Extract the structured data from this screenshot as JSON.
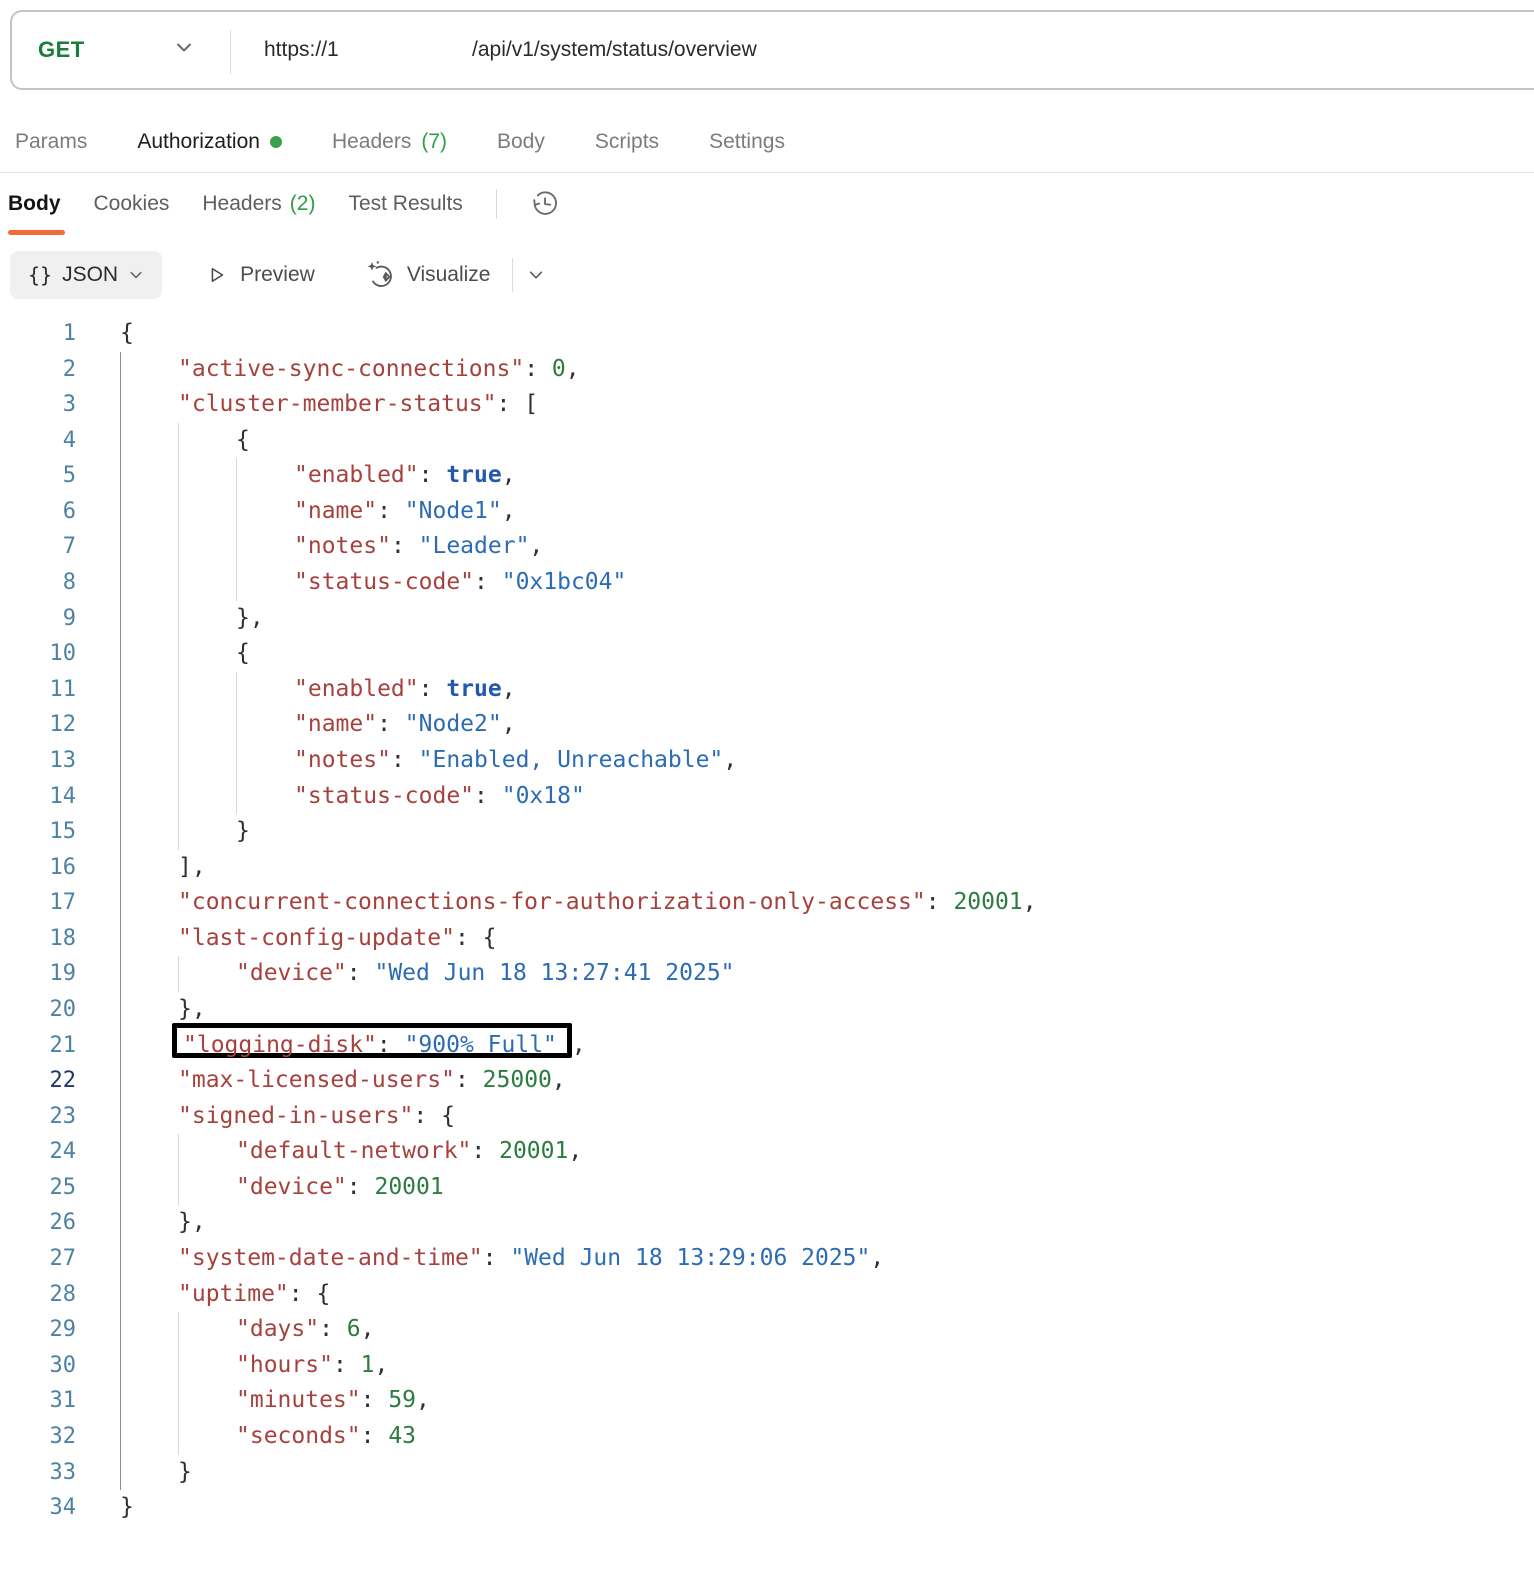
{
  "request_bar": {
    "method": "GET",
    "url_host": "https://1",
    "url_path": "/api/v1/system/status/overview"
  },
  "request_tabs": {
    "items": [
      {
        "label": "Params"
      },
      {
        "label": "Authorization",
        "active": true,
        "dot": true
      },
      {
        "label": "Headers",
        "count": "(7)"
      },
      {
        "label": "Body"
      },
      {
        "label": "Scripts"
      },
      {
        "label": "Settings"
      }
    ]
  },
  "response_tabs": {
    "items": [
      {
        "label": "Body",
        "active": true
      },
      {
        "label": "Cookies"
      },
      {
        "label": "Headers",
        "count": "(2)"
      },
      {
        "label": "Test Results"
      }
    ]
  },
  "toolbar": {
    "format_label": "JSON",
    "braces_glyph": "{}",
    "preview_label": "Preview",
    "visualize_label": "Visualize"
  },
  "icons": {
    "method_dropdown": "chevron-down-icon",
    "format_dropdown": "chevron-down-icon",
    "preview": "play-icon",
    "visualize": "sparkle-wand-icon",
    "history": "history-clock-icon",
    "more_options": "chevron-down-icon"
  },
  "colors": {
    "accent_orange": "#f26a3a",
    "method_green": "#1b7d3c",
    "count_green": "#2f9e44",
    "dot_green": "#3aa14e",
    "token_key": "#a5423e",
    "token_string": "#2b6cb3",
    "token_number": "#2c7c3f",
    "token_boolean": "#2457b0",
    "line_number": "#4d82a3",
    "active_line_number": "#1c3a66",
    "highlight_border": "#000000"
  },
  "response_body": {
    "language": "json",
    "active_line": 22,
    "highlighted_line": 21,
    "lines": [
      {
        "n": 1,
        "d": 0,
        "t": [
          [
            "p",
            "{"
          ]
        ]
      },
      {
        "n": 2,
        "d": 1,
        "t": [
          [
            "k",
            "\"active-sync-connections\""
          ],
          [
            "p",
            ": "
          ],
          [
            "n",
            "0"
          ],
          [
            "p",
            ","
          ]
        ]
      },
      {
        "n": 3,
        "d": 1,
        "t": [
          [
            "k",
            "\"cluster-member-status\""
          ],
          [
            "p",
            ": ["
          ]
        ]
      },
      {
        "n": 4,
        "d": 2,
        "t": [
          [
            "p",
            "{"
          ]
        ]
      },
      {
        "n": 5,
        "d": 3,
        "t": [
          [
            "k",
            "\"enabled\""
          ],
          [
            "p",
            ": "
          ],
          [
            "b",
            "true"
          ],
          [
            "p",
            ","
          ]
        ]
      },
      {
        "n": 6,
        "d": 3,
        "t": [
          [
            "k",
            "\"name\""
          ],
          [
            "p",
            ": "
          ],
          [
            "s",
            "\"Node1\""
          ],
          [
            "p",
            ","
          ]
        ]
      },
      {
        "n": 7,
        "d": 3,
        "t": [
          [
            "k",
            "\"notes\""
          ],
          [
            "p",
            ": "
          ],
          [
            "s",
            "\"Leader\""
          ],
          [
            "p",
            ","
          ]
        ]
      },
      {
        "n": 8,
        "d": 3,
        "t": [
          [
            "k",
            "\"status-code\""
          ],
          [
            "p",
            ": "
          ],
          [
            "s",
            "\"0x1bc04\""
          ]
        ]
      },
      {
        "n": 9,
        "d": 2,
        "t": [
          [
            "p",
            "},"
          ]
        ]
      },
      {
        "n": 10,
        "d": 2,
        "t": [
          [
            "p",
            "{"
          ]
        ]
      },
      {
        "n": 11,
        "d": 3,
        "t": [
          [
            "k",
            "\"enabled\""
          ],
          [
            "p",
            ": "
          ],
          [
            "b",
            "true"
          ],
          [
            "p",
            ","
          ]
        ]
      },
      {
        "n": 12,
        "d": 3,
        "t": [
          [
            "k",
            "\"name\""
          ],
          [
            "p",
            ": "
          ],
          [
            "s",
            "\"Node2\""
          ],
          [
            "p",
            ","
          ]
        ]
      },
      {
        "n": 13,
        "d": 3,
        "t": [
          [
            "k",
            "\"notes\""
          ],
          [
            "p",
            ": "
          ],
          [
            "s",
            "\"Enabled, Unreachable\""
          ],
          [
            "p",
            ","
          ]
        ]
      },
      {
        "n": 14,
        "d": 3,
        "t": [
          [
            "k",
            "\"status-code\""
          ],
          [
            "p",
            ": "
          ],
          [
            "s",
            "\"0x18\""
          ]
        ]
      },
      {
        "n": 15,
        "d": 2,
        "t": [
          [
            "p",
            "}"
          ]
        ]
      },
      {
        "n": 16,
        "d": 1,
        "t": [
          [
            "p",
            "],"
          ]
        ]
      },
      {
        "n": 17,
        "d": 1,
        "t": [
          [
            "k",
            "\"concurrent-connections-for-authorization-only-access\""
          ],
          [
            "p",
            ": "
          ],
          [
            "n",
            "20001"
          ],
          [
            "p",
            ","
          ]
        ]
      },
      {
        "n": 18,
        "d": 1,
        "t": [
          [
            "k",
            "\"last-config-update\""
          ],
          [
            "p",
            ": {"
          ]
        ]
      },
      {
        "n": 19,
        "d": 2,
        "t": [
          [
            "k",
            "\"device\""
          ],
          [
            "p",
            ": "
          ],
          [
            "s",
            "\"Wed Jun 18 13:27:41 2025\""
          ]
        ]
      },
      {
        "n": 20,
        "d": 1,
        "t": [
          [
            "p",
            "},"
          ]
        ]
      },
      {
        "n": 21,
        "d": 1,
        "box": [
          [
            "k",
            "\"logging-disk\""
          ],
          [
            "p",
            ": "
          ],
          [
            "s",
            "\"900% Full\""
          ]
        ],
        "t": [
          [
            "p",
            ","
          ]
        ]
      },
      {
        "n": 22,
        "d": 1,
        "t": [
          [
            "k",
            "\"max-licensed-users\""
          ],
          [
            "p",
            ": "
          ],
          [
            "n",
            "25000"
          ],
          [
            "p",
            ","
          ]
        ]
      },
      {
        "n": 23,
        "d": 1,
        "t": [
          [
            "k",
            "\"signed-in-users\""
          ],
          [
            "p",
            ": {"
          ]
        ]
      },
      {
        "n": 24,
        "d": 2,
        "t": [
          [
            "k",
            "\"default-network\""
          ],
          [
            "p",
            ": "
          ],
          [
            "n",
            "20001"
          ],
          [
            "p",
            ","
          ]
        ]
      },
      {
        "n": 25,
        "d": 2,
        "t": [
          [
            "k",
            "\"device\""
          ],
          [
            "p",
            ": "
          ],
          [
            "n",
            "20001"
          ]
        ]
      },
      {
        "n": 26,
        "d": 1,
        "t": [
          [
            "p",
            "},"
          ]
        ]
      },
      {
        "n": 27,
        "d": 1,
        "t": [
          [
            "k",
            "\"system-date-and-time\""
          ],
          [
            "p",
            ": "
          ],
          [
            "s",
            "\"Wed Jun 18 13:29:06 2025\""
          ],
          [
            "p",
            ","
          ]
        ]
      },
      {
        "n": 28,
        "d": 1,
        "t": [
          [
            "k",
            "\"uptime\""
          ],
          [
            "p",
            ": {"
          ]
        ]
      },
      {
        "n": 29,
        "d": 2,
        "t": [
          [
            "k",
            "\"days\""
          ],
          [
            "p",
            ": "
          ],
          [
            "n",
            "6"
          ],
          [
            "p",
            ","
          ]
        ]
      },
      {
        "n": 30,
        "d": 2,
        "t": [
          [
            "k",
            "\"hours\""
          ],
          [
            "p",
            ": "
          ],
          [
            "n",
            "1"
          ],
          [
            "p",
            ","
          ]
        ]
      },
      {
        "n": 31,
        "d": 2,
        "t": [
          [
            "k",
            "\"minutes\""
          ],
          [
            "p",
            ": "
          ],
          [
            "n",
            "59"
          ],
          [
            "p",
            ","
          ]
        ]
      },
      {
        "n": 32,
        "d": 2,
        "t": [
          [
            "k",
            "\"seconds\""
          ],
          [
            "p",
            ": "
          ],
          [
            "n",
            "43"
          ]
        ]
      },
      {
        "n": 33,
        "d": 1,
        "t": [
          [
            "p",
            "}"
          ]
        ]
      },
      {
        "n": 34,
        "d": 0,
        "t": [
          [
            "p",
            "}"
          ]
        ]
      }
    ]
  }
}
